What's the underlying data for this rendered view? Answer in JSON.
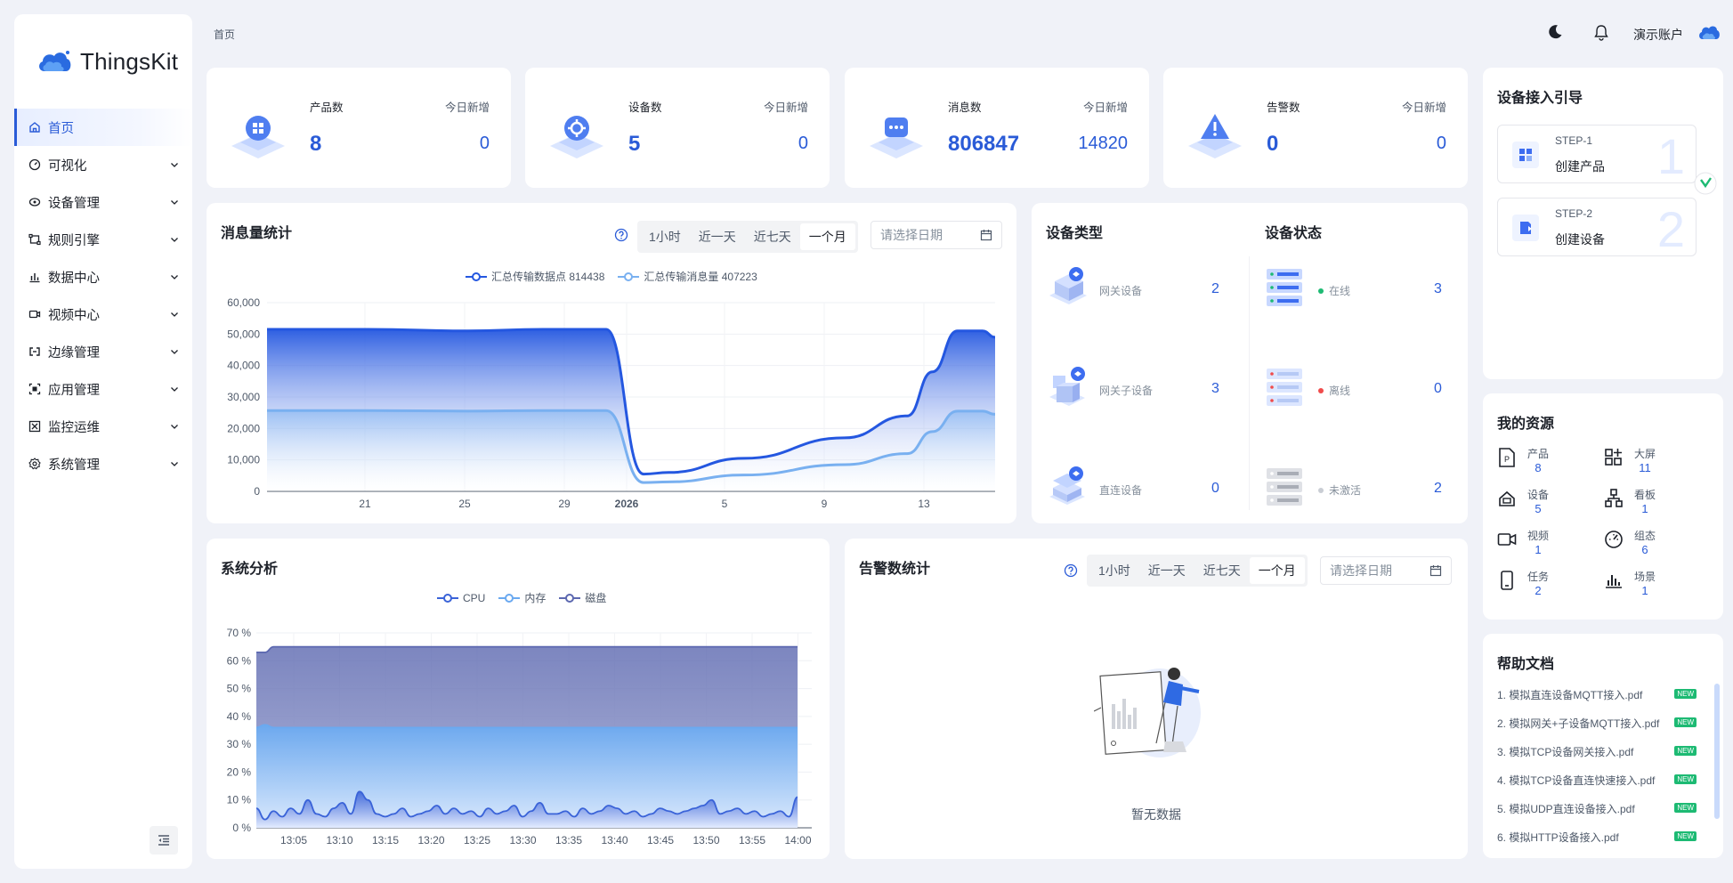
{
  "app": {
    "name": "ThingsKit"
  },
  "breadcrumb": "首页",
  "header": {
    "user": "演示账户"
  },
  "sidebar": {
    "items": [
      {
        "label": "首页",
        "icon": "home-icon"
      },
      {
        "label": "可视化",
        "icon": "dashboard-icon"
      },
      {
        "label": "设备管理",
        "icon": "device-icon"
      },
      {
        "label": "规则引擎",
        "icon": "rule-icon"
      },
      {
        "label": "数据中心",
        "icon": "chart-icon"
      },
      {
        "label": "视频中心",
        "icon": "video-icon"
      },
      {
        "label": "边缘管理",
        "icon": "edge-icon"
      },
      {
        "label": "应用管理",
        "icon": "app-icon"
      },
      {
        "label": "监控运维",
        "icon": "monitor-icon"
      },
      {
        "label": "系统管理",
        "icon": "gear-icon"
      }
    ]
  },
  "stats": [
    {
      "label": "产品数",
      "value": "8",
      "today_label": "今日新增",
      "today_value": "0"
    },
    {
      "label": "设备数",
      "value": "5",
      "today_label": "今日新增",
      "today_value": "0"
    },
    {
      "label": "消息数",
      "value": "806847",
      "today_label": "今日新增",
      "today_value": "14820"
    },
    {
      "label": "告警数",
      "value": "0",
      "today_label": "今日新增",
      "today_value": "0"
    }
  ],
  "range_options": [
    "1小时",
    "近一天",
    "近七天",
    "一个月"
  ],
  "date_placeholder": "请选择日期",
  "message_chart": {
    "title": "消息量统计",
    "legend": [
      "汇总传输数据点 814438",
      "汇总传输消息量 407223"
    ]
  },
  "system_chart": {
    "title": "系统分析",
    "legend": [
      "CPU",
      "内存",
      "磁盘"
    ]
  },
  "alarm_chart": {
    "title": "告警数统计",
    "empty": "暂无数据"
  },
  "chart_data": [
    {
      "type": "area",
      "title": "消息量统计",
      "x_ticks": [
        "21",
        "25",
        "29",
        "2026",
        "5",
        "9",
        "13"
      ],
      "yticks": [
        "0",
        "10,000",
        "20,000",
        "30,000",
        "40,000",
        "50,000",
        "60,000"
      ],
      "ylim": [
        0,
        60000
      ],
      "x": [
        0,
        4,
        8,
        11,
        13.5,
        15,
        16,
        19,
        23,
        25.5,
        26.5,
        27.5,
        28.5,
        29
      ],
      "series": [
        {
          "name": "汇总传输数据点 814438",
          "color": "#2457e0",
          "values": [
            51500,
            51500,
            51000,
            51500,
            51500,
            5500,
            6000,
            10500,
            17000,
            24000,
            38000,
            51000,
            51000,
            49000
          ]
        },
        {
          "name": "汇总传输消息量 407223",
          "color": "#79b0f0",
          "values": [
            25700,
            25700,
            25500,
            25700,
            25700,
            2800,
            3000,
            5200,
            8500,
            12000,
            19000,
            25500,
            25500,
            24500
          ]
        }
      ]
    },
    {
      "type": "area",
      "title": "系统分析",
      "x_ticks": [
        "13:05",
        "13:10",
        "13:15",
        "13:20",
        "13:25",
        "13:30",
        "13:35",
        "13:40",
        "13:45",
        "13:50",
        "13:55",
        "14:00"
      ],
      "yticks": [
        "0 %",
        "10 %",
        "20 %",
        "30 %",
        "40 %",
        "50 %",
        "60 %",
        "70 %"
      ],
      "ylim": [
        0,
        70
      ],
      "series": [
        {
          "name": "磁盘",
          "color": "#5c68b0",
          "values": [
            63,
            63,
            65,
            65,
            65,
            65,
            65,
            65,
            65,
            65,
            65,
            65,
            65,
            65,
            65,
            65,
            65,
            65,
            65,
            65,
            65,
            65,
            65,
            65,
            65,
            65,
            65,
            65,
            65,
            65,
            65,
            65,
            65,
            65,
            65,
            65,
            65,
            65,
            65,
            65,
            65,
            65,
            65,
            65,
            65,
            65,
            65,
            65,
            65,
            65,
            65,
            65,
            65,
            65,
            65,
            65,
            65,
            65,
            65,
            65,
            65,
            65,
            65,
            65
          ]
        },
        {
          "name": "内存",
          "color": "#6aa9f0",
          "values": [
            36,
            37,
            36,
            36,
            36,
            36,
            36,
            36,
            36,
            36,
            36,
            36,
            36,
            36,
            36,
            36,
            36,
            36,
            36,
            36,
            36,
            36,
            36,
            36,
            36,
            36,
            36,
            36,
            36,
            36,
            36,
            36,
            36,
            36,
            36,
            36,
            36,
            36,
            36,
            36,
            36,
            36,
            36,
            36,
            36,
            36,
            36,
            36,
            36,
            36,
            36,
            36,
            36,
            36,
            36,
            36,
            36,
            36,
            36,
            36,
            36,
            36,
            36,
            36
          ]
        },
        {
          "name": "CPU",
          "color": "#3a63d8",
          "values": [
            7,
            3,
            6,
            4,
            7,
            5,
            10,
            5,
            4,
            7,
            9,
            5,
            13,
            10,
            5,
            4,
            5,
            7,
            4,
            5,
            6,
            8,
            5,
            7,
            5,
            6,
            4,
            7,
            5,
            6,
            8,
            4,
            6,
            9,
            5,
            5,
            6,
            4,
            7,
            5,
            6,
            8,
            7,
            5,
            6,
            4,
            5,
            7,
            6,
            5,
            6,
            7,
            8,
            10,
            5,
            6,
            7,
            5,
            6,
            4,
            5,
            6,
            4,
            11
          ]
        }
      ]
    }
  ],
  "device_type": {
    "title": "设备类型",
    "items": [
      {
        "name": "网关设备",
        "count": "2"
      },
      {
        "name": "网关子设备",
        "count": "3"
      },
      {
        "name": "直连设备",
        "count": "0"
      }
    ]
  },
  "device_status": {
    "title": "设备状态",
    "items": [
      {
        "name": "在线",
        "count": "3",
        "color": "#1dba73"
      },
      {
        "name": "离线",
        "count": "0",
        "color": "#f04b4b"
      },
      {
        "name": "未激活",
        "count": "2",
        "color": "#c9cdd4"
      }
    ]
  },
  "guide": {
    "title": "设备接入引导",
    "steps": [
      {
        "tag": "STEP-1",
        "name": "创建产品",
        "num": "1"
      },
      {
        "tag": "STEP-2",
        "name": "创建设备",
        "num": "2"
      }
    ]
  },
  "resources": {
    "title": "我的资源",
    "items": [
      {
        "label": "产品",
        "value": "8",
        "icon": "product-icon"
      },
      {
        "label": "大屏",
        "value": "11",
        "icon": "screen-icon"
      },
      {
        "label": "设备",
        "value": "5",
        "icon": "device-icon"
      },
      {
        "label": "看板",
        "value": "1",
        "icon": "board-icon"
      },
      {
        "label": "视频",
        "value": "1",
        "icon": "video-icon"
      },
      {
        "label": "组态",
        "value": "6",
        "icon": "gauge-icon"
      },
      {
        "label": "任务",
        "value": "2",
        "icon": "task-icon"
      },
      {
        "label": "场景",
        "value": "1",
        "icon": "scene-icon"
      }
    ]
  },
  "help": {
    "title": "帮助文档",
    "badge": "NEW",
    "docs": [
      "1. 模拟直连设备MQTT接入.pdf",
      "2. 模拟网关+子设备MQTT接入.pdf",
      "3. 模拟TCP设备网关接入.pdf",
      "4. 模拟TCP设备直连快速接入.pdf",
      "5. 模拟UDP直连设备接入.pdf",
      "6. 模拟HTTP设备接入.pdf"
    ]
  }
}
